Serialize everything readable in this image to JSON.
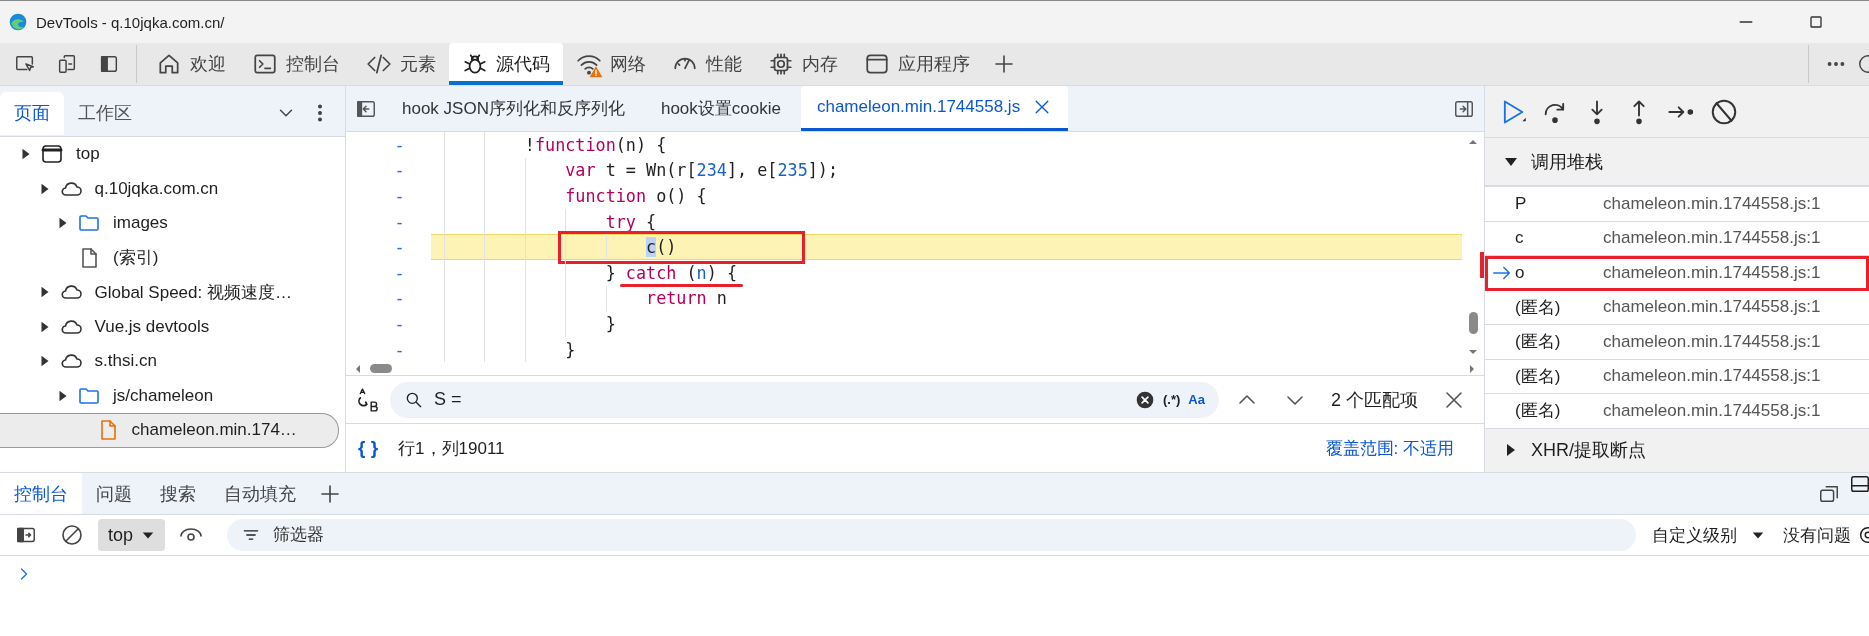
{
  "window": {
    "title": "DevTools - q.10jqka.com.cn/"
  },
  "toolbar": {
    "tabs": [
      {
        "label": "欢迎",
        "selected": false,
        "warning": false
      },
      {
        "label": "控制台",
        "selected": false,
        "warning": false
      },
      {
        "label": "元素",
        "selected": false,
        "warning": false
      },
      {
        "label": "源代码",
        "selected": true,
        "warning": false
      },
      {
        "label": "网络",
        "selected": false,
        "warning": true
      },
      {
        "label": "性能",
        "selected": false,
        "warning": false
      },
      {
        "label": "内存",
        "selected": false,
        "warning": false
      },
      {
        "label": "应用程序",
        "selected": false,
        "warning": false
      }
    ]
  },
  "navigator": {
    "tabs": [
      {
        "label": "页面",
        "selected": true
      },
      {
        "label": "工作区",
        "selected": false
      }
    ],
    "tree": [
      {
        "label": "top",
        "kind": "frame",
        "expanded": false,
        "selected": false,
        "children": [
          {
            "label": "q.10jqka.com.cn",
            "kind": "domain",
            "expanded": false,
            "selected": false,
            "children": [
              {
                "label": "images",
                "kind": "folder",
                "expanded": false,
                "selected": false
              },
              {
                "label": "(索引)",
                "kind": "document",
                "selected": false
              }
            ]
          },
          {
            "label": "Global Speed: 视频速度…",
            "kind": "domain",
            "expanded": false,
            "selected": false
          },
          {
            "label": "Vue.js devtools",
            "kind": "domain",
            "expanded": false,
            "selected": false
          },
          {
            "label": "s.thsi.cn",
            "kind": "domain",
            "expanded": false,
            "selected": false,
            "children": [
              {
                "label": "js/chameleon",
                "kind": "folder",
                "expanded": false,
                "selected": false,
                "children": [
                  {
                    "label": "chameleon.min.174…",
                    "kind": "script",
                    "selected": true
                  }
                ]
              }
            ]
          }
        ]
      }
    ]
  },
  "editor": {
    "tabs": [
      {
        "label": "hook JSON序列化和反序列化",
        "selected": false,
        "closable": false
      },
      {
        "label": "hook设置cookie",
        "selected": false,
        "closable": false
      },
      {
        "label": "chameleon.min.1744558.js",
        "selected": true,
        "closable": true
      }
    ],
    "lines": [
      {
        "gutter": "-",
        "paused": false,
        "boxed": false,
        "underlined": false,
        "tokens": [
          {
            "text": "        !",
            "kind": "plain"
          },
          {
            "text": "function",
            "kind": "keyword"
          },
          {
            "text": "(n) {",
            "kind": "plain"
          }
        ]
      },
      {
        "gutter": "-",
        "paused": false,
        "boxed": false,
        "underlined": false,
        "tokens": [
          {
            "text": "            var",
            "kind": "keyword"
          },
          {
            "text": " t = Wn(r[",
            "kind": "plain"
          },
          {
            "text": "234",
            "kind": "number"
          },
          {
            "text": "], e[",
            "kind": "plain"
          },
          {
            "text": "235",
            "kind": "number"
          },
          {
            "text": "]);",
            "kind": "plain"
          }
        ]
      },
      {
        "gutter": "-",
        "paused": false,
        "boxed": false,
        "underlined": false,
        "tokens": [
          {
            "text": "            function",
            "kind": "keyword"
          },
          {
            "text": " o() {",
            "kind": "plain"
          }
        ]
      },
      {
        "gutter": "-",
        "paused": false,
        "boxed": false,
        "underlined": false,
        "tokens": [
          {
            "text": "                try",
            "kind": "keyword"
          },
          {
            "text": " {",
            "kind": "plain"
          }
        ]
      },
      {
        "gutter": "-",
        "paused": true,
        "boxed": true,
        "underlined": false,
        "tokens": [
          {
            "text": "                    c",
            "kind": "selection"
          },
          {
            "text": "()",
            "kind": "plain"
          }
        ]
      },
      {
        "gutter": "-",
        "paused": false,
        "boxed": false,
        "underlined": true,
        "tokens": [
          {
            "text": "                } ",
            "kind": "plain"
          },
          {
            "text": "catch",
            "kind": "keyword"
          },
          {
            "text": " (",
            "kind": "plain"
          },
          {
            "text": "n",
            "kind": "number"
          },
          {
            "text": ") {",
            "kind": "plain"
          }
        ]
      },
      {
        "gutter": "-",
        "paused": false,
        "boxed": false,
        "underlined": false,
        "tokens": [
          {
            "text": "                    return",
            "kind": "keyword"
          },
          {
            "text": " n",
            "kind": "plain"
          }
        ]
      },
      {
        "gutter": "-",
        "paused": false,
        "boxed": false,
        "underlined": false,
        "tokens": [
          {
            "text": "                }",
            "kind": "plain"
          }
        ]
      },
      {
        "gutter": "-",
        "paused": false,
        "boxed": false,
        "underlined": false,
        "tokens": [
          {
            "text": "            }",
            "kind": "plain"
          }
        ]
      }
    ],
    "search": {
      "value": "S =",
      "regex": "(.*)",
      "match_case": "Aa",
      "match_count": "2 个匹配项"
    },
    "status": {
      "format": "{ }",
      "position": "行1，列19011",
      "coverage": "覆盖范围: 不适用"
    }
  },
  "debugger": {
    "call_stack": {
      "title": "调用堆栈",
      "expanded": true,
      "frames": [
        {
          "name": "P",
          "location": "chameleon.min.1744558.js:1",
          "current": false,
          "annotated": false
        },
        {
          "name": "c",
          "location": "chameleon.min.1744558.js:1",
          "current": false,
          "annotated": false
        },
        {
          "name": "o",
          "location": "chameleon.min.1744558.js:1",
          "current": true,
          "annotated": true
        },
        {
          "name": "(匿名)",
          "location": "chameleon.min.1744558.js:1",
          "current": false,
          "annotated": false
        },
        {
          "name": "(匿名)",
          "location": "chameleon.min.1744558.js:1",
          "current": false,
          "annotated": false
        },
        {
          "name": "(匿名)",
          "location": "chameleon.min.1744558.js:1",
          "current": false,
          "annotated": false
        },
        {
          "name": "(匿名)",
          "location": "chameleon.min.1744558.js:1",
          "current": false,
          "annotated": false
        }
      ]
    },
    "sections": [
      {
        "title": "XHR/提取断点",
        "expanded": false
      }
    ]
  },
  "drawer": {
    "tabs": [
      {
        "label": "控制台",
        "selected": true
      },
      {
        "label": "问题",
        "selected": false
      },
      {
        "label": "搜索",
        "selected": false
      },
      {
        "label": "自动填充",
        "selected": false
      }
    ],
    "context": "top",
    "filter": {
      "placeholder": "筛选器"
    },
    "levels": "自定义级别",
    "issues": "没有问题"
  }
}
